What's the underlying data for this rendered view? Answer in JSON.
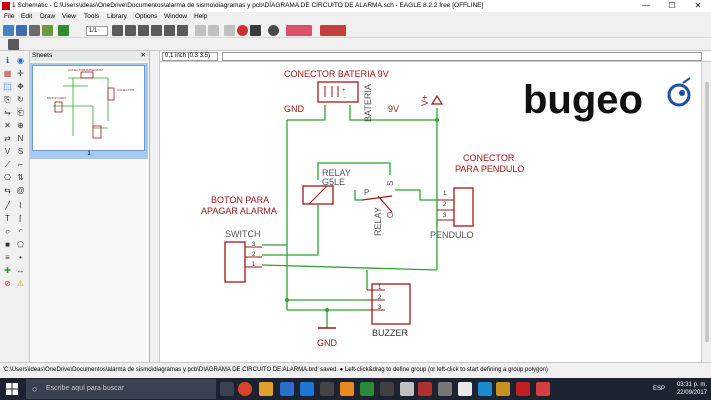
{
  "window": {
    "title": "1 Schematic - C:\\Users\\ideas\\OneDrive\\Documentos\\alarma de sismo\\diagramas y pcb\\DIAGRAMA DE CIRCUITO DE ALARMA.sch - EAGLE 8.2.2 free [OFFLINE]",
    "minimize": "—",
    "maximize": "☐",
    "close": "✕"
  },
  "menu": [
    "File",
    "Edit",
    "Draw",
    "View",
    "Tools",
    "Library",
    "Options",
    "Window",
    "Help"
  ],
  "toolbar": {
    "sheet_select": "1/1"
  },
  "coordbar": {
    "coord": "0.1 inch (0.3 3.5)",
    "command": ""
  },
  "sheets_panel": {
    "title": "Sheets",
    "pin": "🗗",
    "close": "✕",
    "sheet_number": "1"
  },
  "schematic": {
    "labels": {
      "bateria_title": "CONECTOR BATERIA 9V",
      "gnd_top": "GND",
      "bateria": "BATERIA",
      "nine_v": "9V",
      "vplus": "V+",
      "relay_name": "RELAY",
      "relay_model": "G5LE",
      "relay_p": "P",
      "relay_s": "S",
      "relay_o": "O",
      "relay_value": "RELAY",
      "pendulo_title_1": "CONECTOR",
      "pendulo_title_2": "PARA PENDULO",
      "pendulo": "PENDULO",
      "boton_1": "BOTON PARA",
      "boton_2": "APAGAR ALARMA",
      "switch": "SWITCH",
      "buzzer": "BUZZER",
      "gnd_bottom": "GND",
      "pin1": "1",
      "pin2": "2",
      "pin3": "3"
    },
    "logo": "bugeo"
  },
  "status": {
    "message": "'C:\\Users\\ideas\\OneDrive\\Documentos\\alarma de sismo\\diagramas y pcb\\DIAGRAMA DE CIRCUITO DE ALARMA.brd' saved.  ● Left-click&drag to define group (or left-click to start defining a group polygon)"
  },
  "taskbar": {
    "search_placeholder": "Escribe aquí para buscar",
    "lang": "ESP",
    "time": "03:31 p. m.",
    "date": "22/09/2017"
  },
  "colors": {
    "wire": "#2ca52c",
    "part": "#a31616",
    "text_part": "#6f6f6f",
    "label": "#b02020",
    "supply": "#a31616"
  }
}
